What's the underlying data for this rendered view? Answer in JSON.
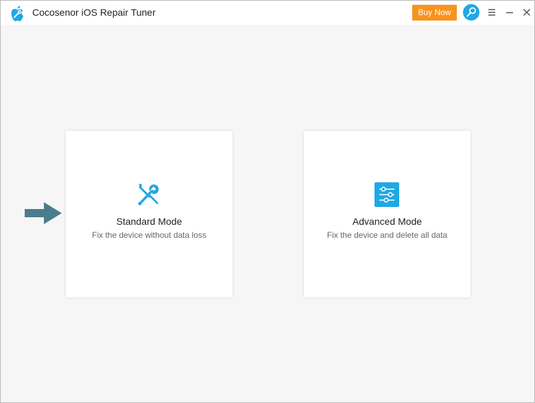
{
  "window": {
    "title": "Cocosenor iOS Repair Tuner",
    "logo_icon": "apple-wrench-logo-icon"
  },
  "header": {
    "buy_label": "Buy Now",
    "search_icon": "magnifier-key-icon",
    "menu_icon": "hamburger-menu-icon",
    "minimize_icon": "minimize-icon",
    "close_icon": "close-icon"
  },
  "modes": [
    {
      "title": "Standard Mode",
      "description": "Fix the device without data loss",
      "icon": "wrench-screwdriver-icon"
    },
    {
      "title": "Advanced Mode",
      "description": "Fix the device and delete all data",
      "icon": "sliders-panel-icon"
    }
  ],
  "colors": {
    "accent": "#1fa8e3",
    "buy_button": "#f7931e",
    "arrow": "#4a7d8c",
    "background": "#f6f6f6"
  }
}
